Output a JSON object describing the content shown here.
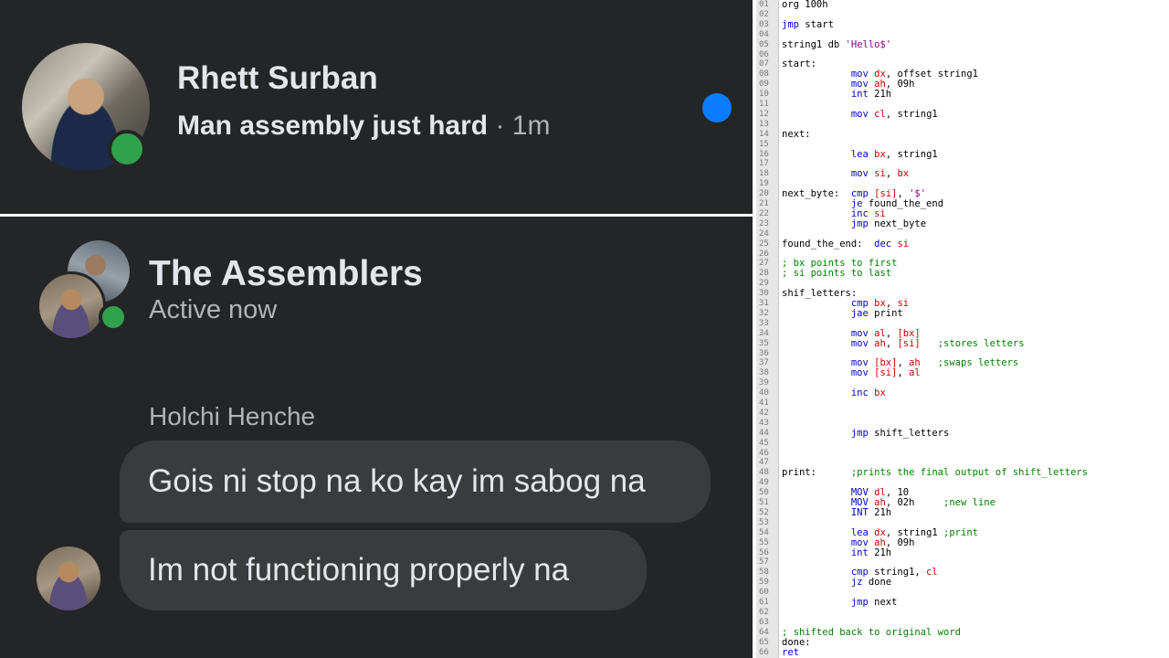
{
  "conversation_list": {
    "contact_name": "Rhett Surban",
    "last_message": "Man assembly just hard",
    "separator": " · ",
    "time": "1m",
    "colors": {
      "unread": "#0a7cff",
      "online": "#31a24c",
      "background": "#242526"
    }
  },
  "chat": {
    "group_name": "The Assemblers",
    "status": "Active now",
    "sender": "Holchi Henche",
    "messages": [
      "Gois ni stop na ko kay im sabog na",
      "Im not functioning properly na"
    ]
  },
  "code_editor": {
    "lines": [
      {
        "n": "01",
        "t": [
          [
            "",
            "org 100h"
          ]
        ]
      },
      {
        "n": "02",
        "t": []
      },
      {
        "n": "03",
        "t": [
          [
            "kw",
            "jmp"
          ],
          [
            "",
            " start"
          ]
        ]
      },
      {
        "n": "04",
        "t": []
      },
      {
        "n": "05",
        "t": [
          [
            "",
            "string1 db "
          ],
          [
            "str",
            "'Hello$'"
          ]
        ]
      },
      {
        "n": "06",
        "t": []
      },
      {
        "n": "07",
        "t": [
          [
            "",
            "start:"
          ]
        ]
      },
      {
        "n": "08",
        "t": [
          [
            "",
            "            "
          ],
          [
            "kw",
            "mov"
          ],
          [
            "",
            " "
          ],
          [
            "reg",
            "dx"
          ],
          [
            "",
            ", offset string1"
          ]
        ]
      },
      {
        "n": "09",
        "t": [
          [
            "",
            "            "
          ],
          [
            "kw",
            "mov"
          ],
          [
            "",
            " "
          ],
          [
            "reg",
            "ah"
          ],
          [
            "",
            ", 09h"
          ]
        ]
      },
      {
        "n": "10",
        "t": [
          [
            "",
            "            "
          ],
          [
            "kw",
            "int"
          ],
          [
            "",
            " 21h"
          ]
        ]
      },
      {
        "n": "11",
        "t": []
      },
      {
        "n": "12",
        "t": [
          [
            "",
            "            "
          ],
          [
            "kw",
            "mov"
          ],
          [
            "",
            " "
          ],
          [
            "reg",
            "cl"
          ],
          [
            "",
            ", string1"
          ]
        ]
      },
      {
        "n": "13",
        "t": []
      },
      {
        "n": "14",
        "t": [
          [
            "",
            "next:"
          ]
        ]
      },
      {
        "n": "15",
        "t": []
      },
      {
        "n": "16",
        "t": [
          [
            "",
            "            "
          ],
          [
            "kw",
            "lea"
          ],
          [
            "",
            " "
          ],
          [
            "reg",
            "bx"
          ],
          [
            "",
            ", string1"
          ]
        ]
      },
      {
        "n": "17",
        "t": []
      },
      {
        "n": "18",
        "t": [
          [
            "",
            "            "
          ],
          [
            "kw",
            "mov"
          ],
          [
            "",
            " "
          ],
          [
            "reg",
            "si"
          ],
          [
            "",
            ", "
          ],
          [
            "reg",
            "bx"
          ]
        ]
      },
      {
        "n": "19",
        "t": []
      },
      {
        "n": "20",
        "t": [
          [
            "",
            "next_byte:  "
          ],
          [
            "kw",
            "cmp"
          ],
          [
            "",
            " "
          ],
          [
            "reg",
            "[si]"
          ],
          [
            "",
            ", "
          ],
          [
            "str",
            "'$'"
          ]
        ]
      },
      {
        "n": "21",
        "t": [
          [
            "",
            "            "
          ],
          [
            "kw",
            "je"
          ],
          [
            "",
            " found_the_end"
          ]
        ]
      },
      {
        "n": "22",
        "t": [
          [
            "",
            "            "
          ],
          [
            "kw",
            "inc"
          ],
          [
            "",
            " "
          ],
          [
            "reg",
            "si"
          ]
        ]
      },
      {
        "n": "23",
        "t": [
          [
            "",
            "            "
          ],
          [
            "kw",
            "jmp"
          ],
          [
            "",
            " next_byte"
          ]
        ]
      },
      {
        "n": "24",
        "t": []
      },
      {
        "n": "25",
        "t": [
          [
            "",
            "found_the_end:  "
          ],
          [
            "kw",
            "dec"
          ],
          [
            "",
            " "
          ],
          [
            "reg",
            "si"
          ]
        ]
      },
      {
        "n": "26",
        "t": []
      },
      {
        "n": "27",
        "t": [
          [
            "cm",
            "; bx points to first"
          ]
        ]
      },
      {
        "n": "28",
        "t": [
          [
            "cm",
            "; si points to last"
          ]
        ]
      },
      {
        "n": "29",
        "t": []
      },
      {
        "n": "30",
        "t": [
          [
            "",
            "shif_letters:"
          ]
        ]
      },
      {
        "n": "31",
        "t": [
          [
            "",
            "            "
          ],
          [
            "kw",
            "cmp"
          ],
          [
            "",
            " "
          ],
          [
            "reg",
            "bx"
          ],
          [
            "",
            ", "
          ],
          [
            "reg",
            "si"
          ]
        ]
      },
      {
        "n": "32",
        "t": [
          [
            "",
            "            "
          ],
          [
            "kw",
            "jae"
          ],
          [
            "",
            " print"
          ]
        ]
      },
      {
        "n": "33",
        "t": []
      },
      {
        "n": "34",
        "t": [
          [
            "",
            "            "
          ],
          [
            "kw",
            "mov"
          ],
          [
            "",
            " "
          ],
          [
            "reg",
            "al"
          ],
          [
            "",
            ", "
          ],
          [
            "reg",
            "[bx]"
          ]
        ]
      },
      {
        "n": "35",
        "t": [
          [
            "",
            "            "
          ],
          [
            "kw",
            "mov"
          ],
          [
            "",
            " "
          ],
          [
            "reg",
            "ah"
          ],
          [
            "",
            ", "
          ],
          [
            "reg",
            "[si]"
          ],
          [
            "",
            "   "
          ],
          [
            "cm",
            ";stores letters"
          ]
        ]
      },
      {
        "n": "36",
        "t": []
      },
      {
        "n": "37",
        "t": [
          [
            "",
            "            "
          ],
          [
            "kw",
            "mov"
          ],
          [
            "",
            " "
          ],
          [
            "reg",
            "[bx]"
          ],
          [
            "",
            ", "
          ],
          [
            "reg",
            "ah"
          ],
          [
            "",
            "   "
          ],
          [
            "cm",
            ";swaps letters"
          ]
        ]
      },
      {
        "n": "38",
        "t": [
          [
            "",
            "            "
          ],
          [
            "kw",
            "mov"
          ],
          [
            "",
            " "
          ],
          [
            "reg",
            "[si]"
          ],
          [
            "",
            ", "
          ],
          [
            "reg",
            "al"
          ]
        ]
      },
      {
        "n": "39",
        "t": []
      },
      {
        "n": "40",
        "t": [
          [
            "",
            "            "
          ],
          [
            "kw",
            "inc"
          ],
          [
            "",
            " "
          ],
          [
            "reg",
            "bx"
          ]
        ]
      },
      {
        "n": "41",
        "t": []
      },
      {
        "n": "42",
        "t": []
      },
      {
        "n": "43",
        "t": []
      },
      {
        "n": "44",
        "t": [
          [
            "",
            "            "
          ],
          [
            "kw",
            "jmp"
          ],
          [
            "",
            " shift_letters"
          ]
        ]
      },
      {
        "n": "45",
        "t": []
      },
      {
        "n": "46",
        "t": []
      },
      {
        "n": "47",
        "t": []
      },
      {
        "n": "48",
        "t": [
          [
            "",
            "print:      "
          ],
          [
            "cm",
            ";prints the final output of shift_letters"
          ]
        ]
      },
      {
        "n": "49",
        "t": []
      },
      {
        "n": "50",
        "t": [
          [
            "",
            "            "
          ],
          [
            "kw",
            "MOV"
          ],
          [
            "",
            " "
          ],
          [
            "reg",
            "dl"
          ],
          [
            "",
            ", 10"
          ]
        ]
      },
      {
        "n": "51",
        "t": [
          [
            "",
            "            "
          ],
          [
            "kw",
            "MOV"
          ],
          [
            "",
            " "
          ],
          [
            "reg",
            "ah"
          ],
          [
            "",
            ", 02h     "
          ],
          [
            "cm",
            ";new line"
          ]
        ]
      },
      {
        "n": "52",
        "t": [
          [
            "",
            "            "
          ],
          [
            "kw",
            "INT"
          ],
          [
            "",
            " 21h"
          ]
        ]
      },
      {
        "n": "53",
        "t": []
      },
      {
        "n": "54",
        "t": [
          [
            "",
            "            "
          ],
          [
            "kw",
            "lea"
          ],
          [
            "",
            " "
          ],
          [
            "reg",
            "dx"
          ],
          [
            "",
            ", string1 "
          ],
          [
            "cm",
            ";print"
          ]
        ]
      },
      {
        "n": "55",
        "t": [
          [
            "",
            "            "
          ],
          [
            "kw",
            "mov"
          ],
          [
            "",
            " "
          ],
          [
            "reg",
            "ah"
          ],
          [
            "",
            ", 09h"
          ]
        ]
      },
      {
        "n": "56",
        "t": [
          [
            "",
            "            "
          ],
          [
            "kw",
            "int"
          ],
          [
            "",
            " 21h"
          ]
        ]
      },
      {
        "n": "57",
        "t": []
      },
      {
        "n": "58",
        "t": [
          [
            "",
            "            "
          ],
          [
            "kw",
            "cmp"
          ],
          [
            "",
            " string1, "
          ],
          [
            "reg",
            "cl"
          ]
        ]
      },
      {
        "n": "59",
        "t": [
          [
            "",
            "            "
          ],
          [
            "kw",
            "jz"
          ],
          [
            "",
            " done"
          ]
        ]
      },
      {
        "n": "60",
        "t": []
      },
      {
        "n": "61",
        "t": [
          [
            "",
            "            "
          ],
          [
            "kw",
            "jmp"
          ],
          [
            "",
            " next"
          ]
        ]
      },
      {
        "n": "62",
        "t": []
      },
      {
        "n": "63",
        "t": []
      },
      {
        "n": "64",
        "t": [
          [
            "cm",
            "; shifted back to original word"
          ]
        ]
      },
      {
        "n": "65",
        "t": [
          [
            "",
            "done:"
          ]
        ]
      },
      {
        "n": "66",
        "t": [
          [
            "kw",
            "ret"
          ]
        ]
      }
    ]
  }
}
